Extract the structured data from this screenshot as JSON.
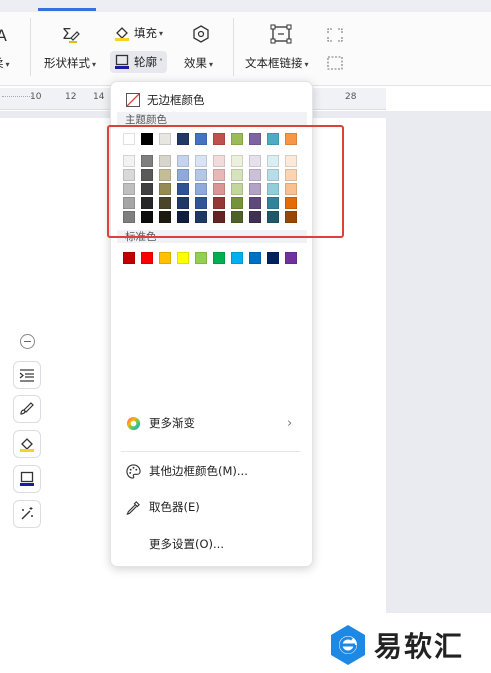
{
  "ribbon": {
    "left_partial_label": "柔",
    "shape_style_label": "形状样式",
    "fill_label": "填充",
    "outline_label": "轮廓",
    "effect_label": "效果",
    "textbox_link_label": "文本框链接"
  },
  "ruler": {
    "ticks": [
      "10",
      "12",
      "14",
      "28"
    ]
  },
  "dropdown": {
    "no_border_label": "无边框颜色",
    "theme_colors_label": "主题颜色",
    "standard_colors_label": "标准色",
    "more_gradient_label": "更多渐变",
    "other_border_color_label": "其他边框颜色(M)...",
    "eyedropper_label": "取色器(E)",
    "more_settings_label": "更多设置(O)..."
  },
  "colors": {
    "theme_top": [
      "#ffffff",
      "#000000",
      "#e7e6e0",
      "#1f3864",
      "#4472c4",
      "#c0504d",
      "#9bbb59",
      "#8064a2",
      "#4bacc6",
      "#f79646"
    ],
    "theme_shades": [
      [
        "#f2f2f2",
        "#7f7f7f",
        "#d8d6cc",
        "#c5d4ec",
        "#dae3f3",
        "#f2dcdb",
        "#ebf1dd",
        "#e5e0ec",
        "#dbeef3",
        "#fde9d9"
      ],
      [
        "#d9d9d9",
        "#595959",
        "#c4bd97",
        "#8eaadb",
        "#b4c7e7",
        "#e6b8b7",
        "#d7e3bc",
        "#ccc1d9",
        "#b7dde8",
        "#fbd4b4"
      ],
      [
        "#bfbfbf",
        "#404040",
        "#948a54",
        "#2f5496",
        "#8faadc",
        "#da9694",
        "#c3d69b",
        "#b2a2c7",
        "#92cddc",
        "#fac08f"
      ],
      [
        "#a6a6a6",
        "#262626",
        "#4a452a",
        "#1f3864",
        "#2f5597",
        "#953734",
        "#76923c",
        "#5f497a",
        "#31859b",
        "#e36c09"
      ],
      [
        "#7f7f7f",
        "#0d0d0d",
        "#1d1b10",
        "#0f1f3d",
        "#1f3864",
        "#632523",
        "#4f6128",
        "#3f3151",
        "#205867",
        "#974806"
      ]
    ],
    "standard": [
      "#c00000",
      "#ff0000",
      "#ffc000",
      "#ffff00",
      "#92d050",
      "#00b050",
      "#00b0f0",
      "#0070c0",
      "#002060",
      "#7030a0"
    ]
  },
  "side_toolbar": {
    "icons": [
      "collapse-icon",
      "text-wrap-icon",
      "style-brush-icon",
      "fill-bucket-icon",
      "outline-icon",
      "effects-wand-icon"
    ]
  },
  "watermark": {
    "text": "易软汇"
  }
}
